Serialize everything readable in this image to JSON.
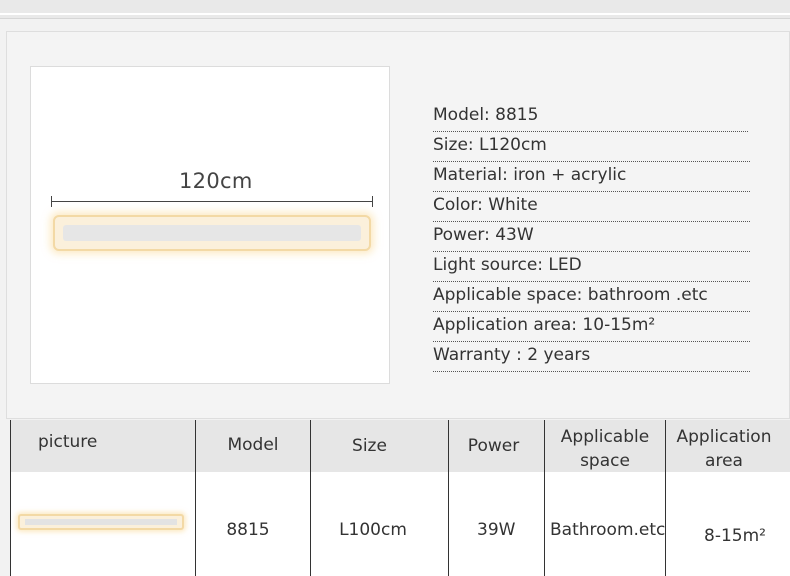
{
  "product": {
    "dimension_label": "120cm"
  },
  "specs": [
    "Model: 8815",
    "Size: L120cm",
    "Material: iron + acrylic",
    "Color: White",
    "Power: 43W",
    "Light source: LED",
    "Applicable space: bathroom .etc",
    "Application area: 10-15m²",
    "Warranty : 2 years"
  ],
  "table": {
    "headers": {
      "picture": "picture",
      "model": "Model",
      "size": "Size",
      "power": "Power",
      "space_line1": "Applicable",
      "space_line2": "space",
      "area_line1": "Application",
      "area_line2": "area"
    },
    "row": {
      "model": "8815",
      "size": "L100cm",
      "power": "39W",
      "space": "Bathroom.etc",
      "area": "8-15m²"
    }
  }
}
